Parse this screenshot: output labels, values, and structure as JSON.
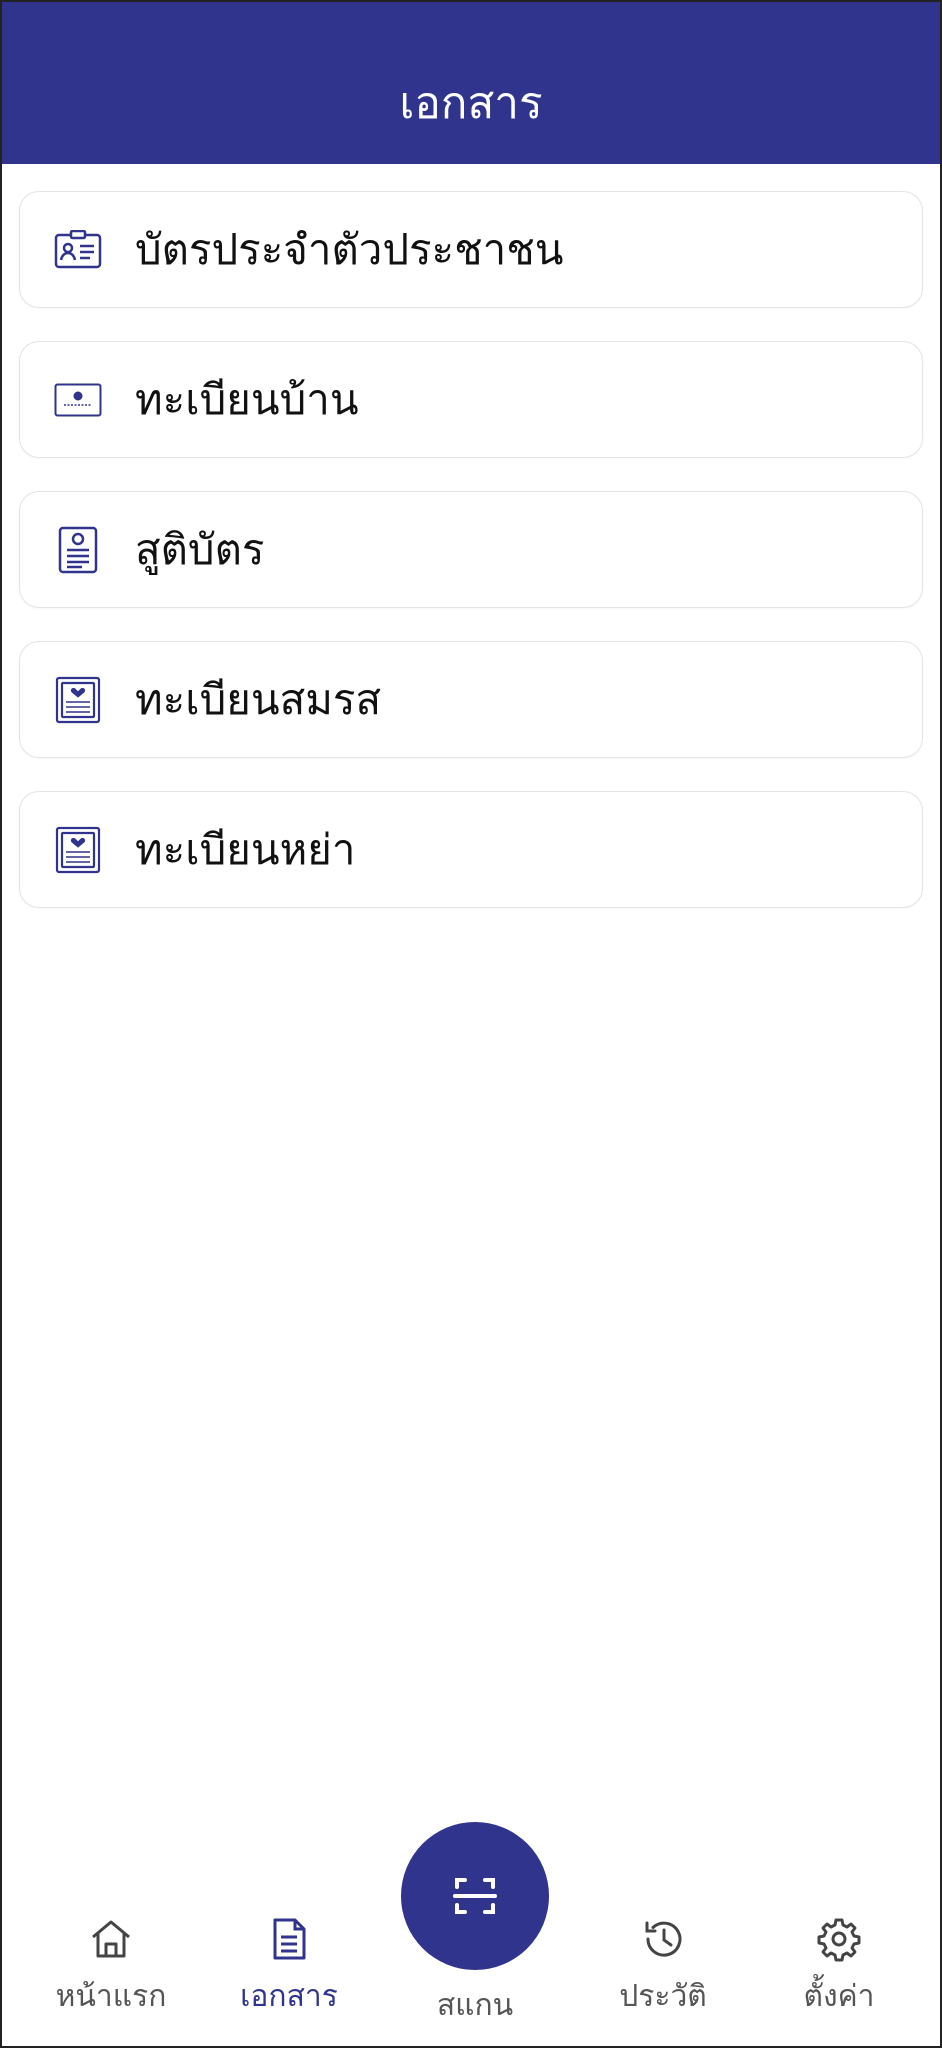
{
  "header": {
    "title": "เอกสาร"
  },
  "documents": [
    {
      "label": "บัตรประจำตัวประชาชน",
      "icon": "id-card-icon"
    },
    {
      "label": "ทะเบียนบ้าน",
      "icon": "house-registration-icon"
    },
    {
      "label": "สูติบัตร",
      "icon": "birth-certificate-icon"
    },
    {
      "label": "ทะเบียนสมรส",
      "icon": "marriage-certificate-icon"
    },
    {
      "label": "ทะเบียนหย่า",
      "icon": "divorce-certificate-icon"
    }
  ],
  "nav": {
    "home": {
      "label": "หน้าแรก",
      "icon": "home-icon"
    },
    "documents": {
      "label": "เอกสาร",
      "icon": "document-icon"
    },
    "scan": {
      "label": "สแกน",
      "icon": "scan-icon"
    },
    "history": {
      "label": "ประวัติ",
      "icon": "history-icon"
    },
    "settings": {
      "label": "ตั้งค่า",
      "icon": "gear-icon"
    }
  },
  "colors": {
    "primary": "#30348c",
    "text": "#111111",
    "nav_text": "#555555",
    "card_border": "#e3e3e8"
  }
}
